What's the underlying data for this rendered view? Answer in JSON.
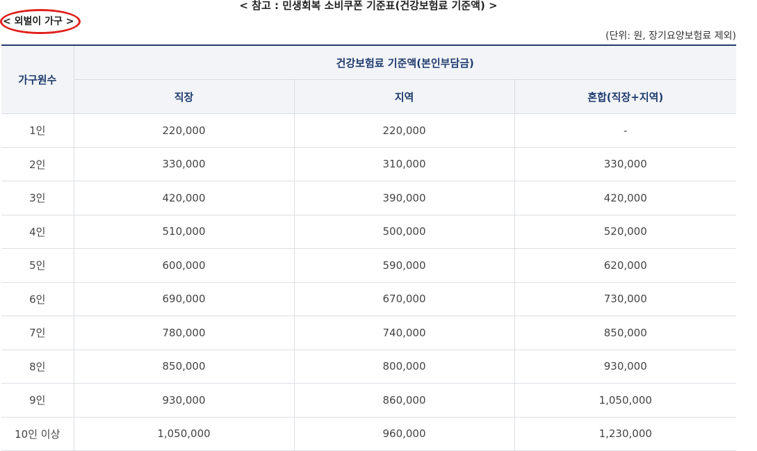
{
  "page": {
    "title": "< 참고 : 민생회복 소비쿠폰 기준표(건강보험료 기준액) >",
    "household_label": "< 외벌이 가구 >",
    "unit_note": "(단위: 원, 장기요양보험료 제외)"
  },
  "table": {
    "corner_header": "가구원수",
    "group_header": "건강보험료 기준액(본인부담금)",
    "columns": [
      "직장",
      "지역",
      "혼합(직장+지역)"
    ],
    "rows": [
      {
        "household": "1인",
        "workplace": "220,000",
        "regional": "220,000",
        "mixed": "-"
      },
      {
        "household": "2인",
        "workplace": "330,000",
        "regional": "310,000",
        "mixed": "330,000"
      },
      {
        "household": "3인",
        "workplace": "420,000",
        "regional": "390,000",
        "mixed": "420,000"
      },
      {
        "household": "4인",
        "workplace": "510,000",
        "regional": "500,000",
        "mixed": "520,000"
      },
      {
        "household": "5인",
        "workplace": "600,000",
        "regional": "590,000",
        "mixed": "620,000"
      },
      {
        "household": "6인",
        "workplace": "690,000",
        "regional": "670,000",
        "mixed": "730,000"
      },
      {
        "household": "7인",
        "workplace": "780,000",
        "regional": "740,000",
        "mixed": "850,000"
      },
      {
        "household": "8인",
        "workplace": "850,000",
        "regional": "800,000",
        "mixed": "930,000"
      },
      {
        "household": "9인",
        "workplace": "930,000",
        "regional": "860,000",
        "mixed": "1,050,000"
      },
      {
        "household": "10인 이상",
        "workplace": "1,050,000",
        "regional": "960,000",
        "mixed": "1,230,000"
      }
    ]
  },
  "colors": {
    "header_text": "#1f3b6e",
    "header_bg": "#f2f4f7",
    "highlight_ellipse": "#e0201b"
  }
}
